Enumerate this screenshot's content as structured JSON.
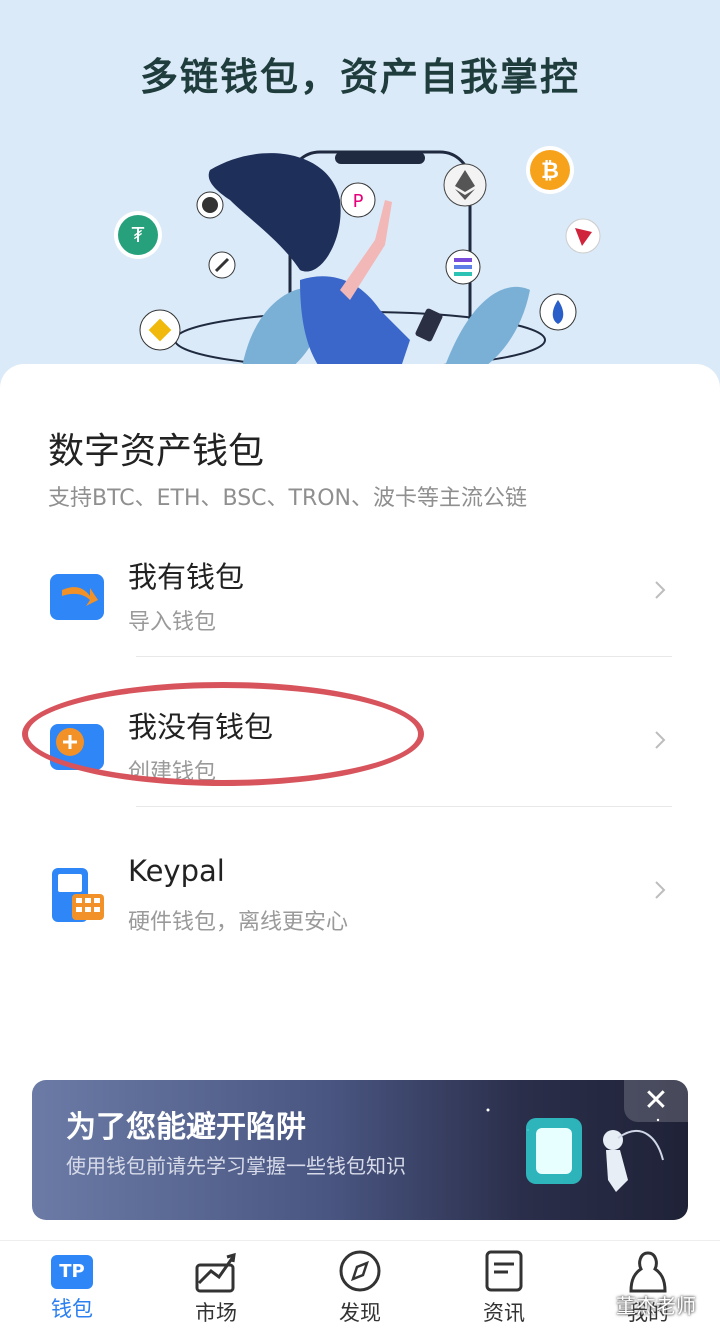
{
  "hero": {
    "title": "多链钱包，资产自我掌控"
  },
  "card": {
    "title": "数字资产钱包",
    "subtitle": "支持BTC、ETH、BSC、TRON、波卡等主流公链",
    "options": [
      {
        "label": "我有钱包",
        "desc": "导入钱包",
        "icon": "import-wallet-icon"
      },
      {
        "label": "我没有钱包",
        "desc": "创建钱包",
        "icon": "create-wallet-icon"
      },
      {
        "label": "Keypal",
        "desc": "硬件钱包，离线更安心",
        "icon": "hardware-wallet-icon"
      }
    ]
  },
  "banner": {
    "title": "为了您能避开陷阱",
    "desc": "使用钱包前请先学习掌握一些钱包知识",
    "close": "✕"
  },
  "tabs": [
    {
      "label": "钱包",
      "icon": "wallet-tp-icon",
      "active": true
    },
    {
      "label": "市场",
      "icon": "market-chart-icon",
      "active": false
    },
    {
      "label": "发现",
      "icon": "compass-icon",
      "active": false
    },
    {
      "label": "资讯",
      "icon": "news-icon",
      "active": false
    },
    {
      "label": "我的",
      "icon": "profile-icon",
      "active": false
    }
  ],
  "colors": {
    "accent": "#2c7ff0",
    "hero_bg": "#dbeaf8",
    "highlight_ring": "#d8545d"
  },
  "watermark": "董杰老师"
}
